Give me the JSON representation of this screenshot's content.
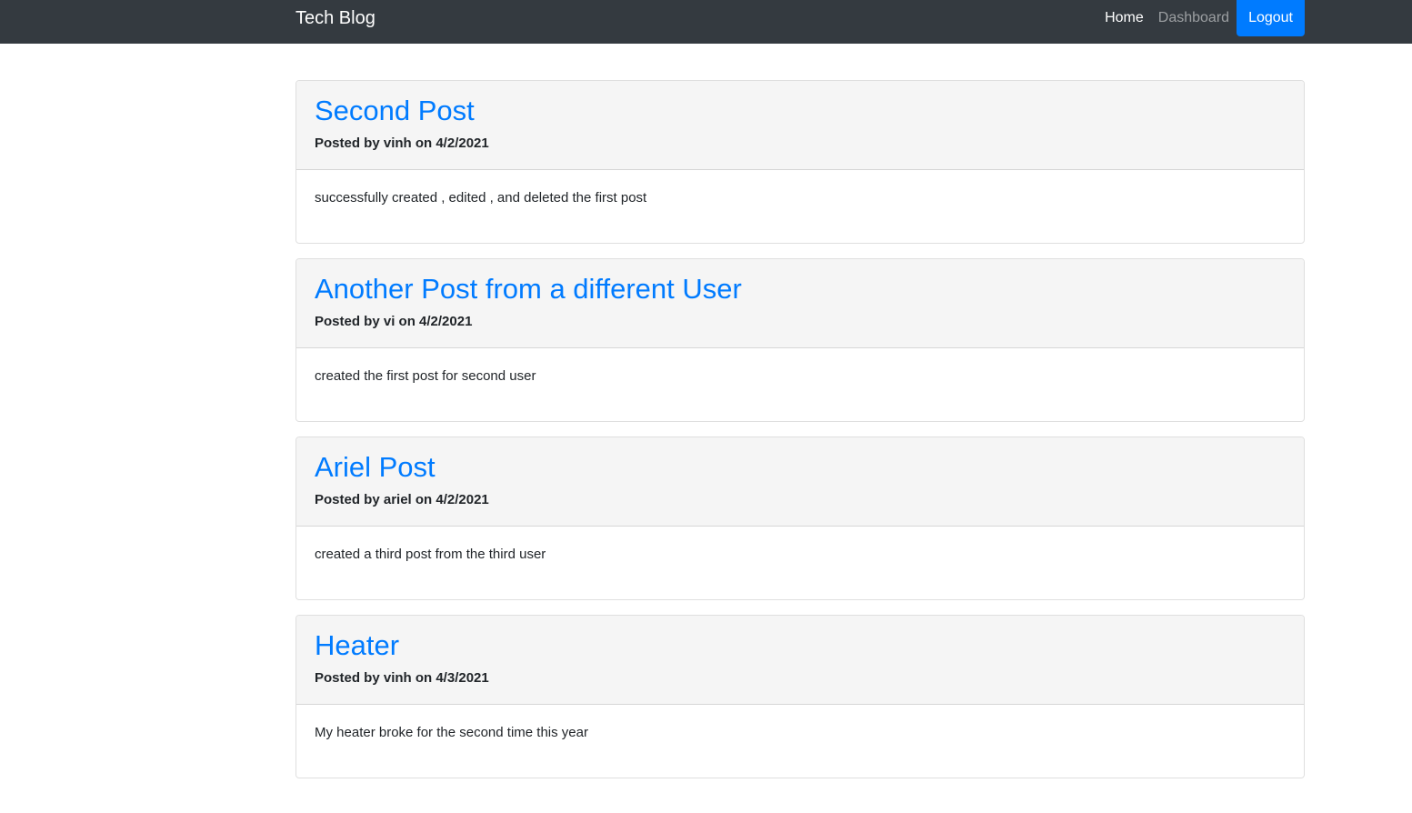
{
  "navbar": {
    "brand": "Tech Blog",
    "home_label": "Home",
    "dashboard_label": "Dashboard",
    "logout_label": "Logout"
  },
  "posts": [
    {
      "title": "Second Post",
      "meta": "Posted by vinh on 4/2/2021",
      "body": "successfully created , edited , and deleted the first post"
    },
    {
      "title": "Another Post from a different User",
      "meta": "Posted by vi on 4/2/2021",
      "body": "created the first post for second user"
    },
    {
      "title": "Ariel Post",
      "meta": "Posted by ariel on 4/2/2021",
      "body": "created a third post from the third user"
    },
    {
      "title": "Heater",
      "meta": "Posted by vinh on 4/3/2021",
      "body": "My heater broke for the second time this year"
    }
  ]
}
